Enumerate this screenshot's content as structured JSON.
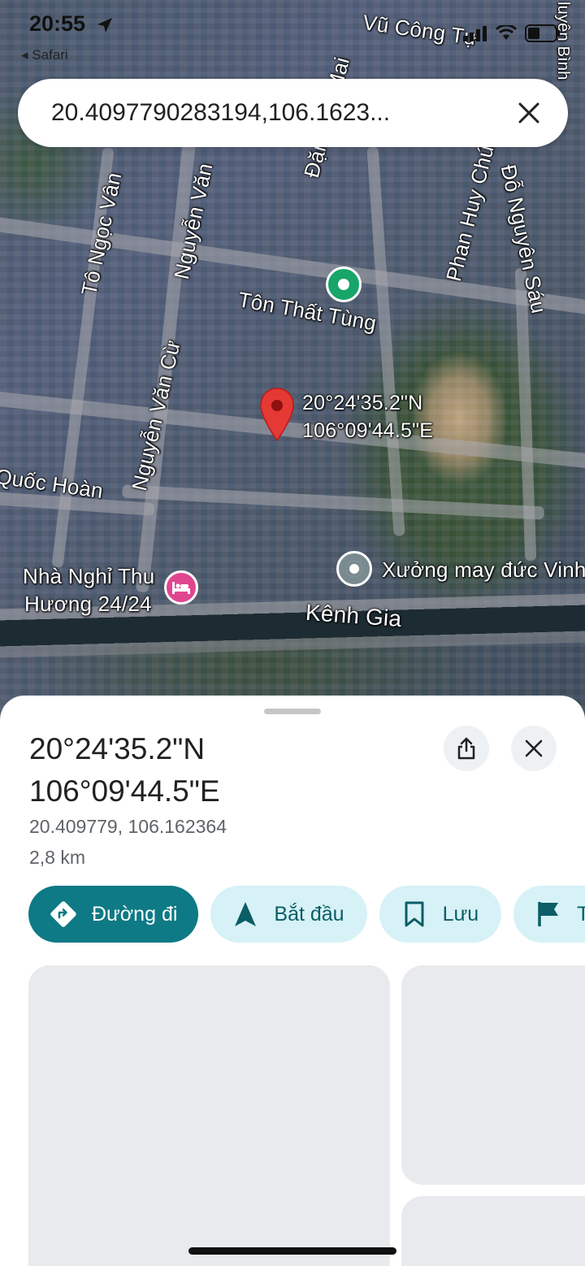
{
  "status_bar": {
    "time": "20:55",
    "back_app": "Safari"
  },
  "search": {
    "query": "20.4097790283194,106.1623..."
  },
  "map": {
    "street_labels": {
      "vu_cong_tu": "Vũ Công Tự",
      "mai": "Mai",
      "dang": "Đặng",
      "to_ngoc_van": "Tô Ngọc Vân",
      "nguyen_van_top": "Nguyễn Văn",
      "phan_huy_chu": "Phan Huy Chú",
      "do_nguyen_sau": "Đỗ Nguyên Sáu",
      "ton_that_tung": "Tôn Thất Tùng",
      "nguyen_van_cu": "Nguyễn Văn Cừ",
      "quoc_hoan": "Quốc Hoàn",
      "kenh_gia": "Kênh Gia",
      "corner_top_right": "luyện Bình"
    },
    "pin_label_lat": "20°24'35.2\"N",
    "pin_label_lng": "106°09'44.5\"E",
    "poi_hotel": "Nhà Nghỉ Thu Hương 24/24",
    "poi_hotel_line1": "Nhà Nghỉ Thu",
    "poi_hotel_line2": "Hương 24/24",
    "poi_factory": "Xưởng may đức Vinh",
    "colors": {
      "pin_red": "#e53935",
      "poi_green": "#17a56a",
      "poi_pink": "#e0468f"
    }
  },
  "place": {
    "title_line1": "20°24'35.2\"N",
    "title_line2": "106°09'44.5\"E",
    "decimal": "20.409779, 106.162364",
    "distance": "2,8 km"
  },
  "actions": [
    {
      "label": "Đường đi",
      "icon": "directions-icon"
    },
    {
      "label": "Bắt đầu",
      "icon": "navigation-arrow-icon"
    },
    {
      "label": "Lưu",
      "icon": "bookmark-icon"
    },
    {
      "label": "T",
      "icon": "flag-icon"
    }
  ],
  "colors": {
    "primary": "#0d7a85",
    "chip_bg": "#d6f2f7"
  }
}
